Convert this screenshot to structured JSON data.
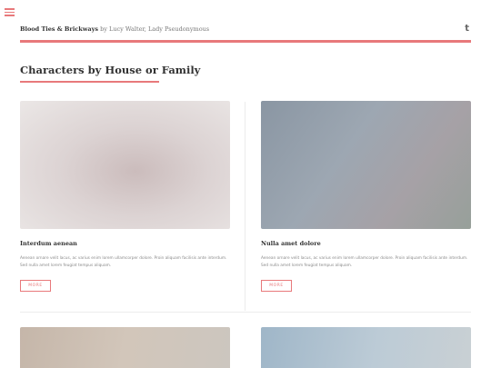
{
  "header": {
    "site_name": "Blood Ties & Brickways",
    "byline": "by Lucy Walter, Lady Pseudonymous",
    "tumblr_glyph": "t"
  },
  "icons": {
    "menu": "menu-icon",
    "tumblr": "tumblr-icon"
  },
  "colors": {
    "accent": "#e8797b"
  },
  "section": {
    "title": "Characters by House or Family"
  },
  "cards": [
    {
      "title": "Interdum aenean",
      "text": "Aenean ornare velit lacus, ac varius enim lorem ullamcorper dolore. Proin aliquam facilisis ante interdum. Sed nulla amet lorem feugiat tempus aliquam.",
      "button": "MORE"
    },
    {
      "title": "Nulla amet dolore",
      "text": "Aenean ornare velit lacus, ac varius enim lorem ullamcorper dolore. Proin aliquam facilisis ante interdum. Sed nulla amet lorem feugiat tempus aliquam.",
      "button": "MORE"
    }
  ]
}
